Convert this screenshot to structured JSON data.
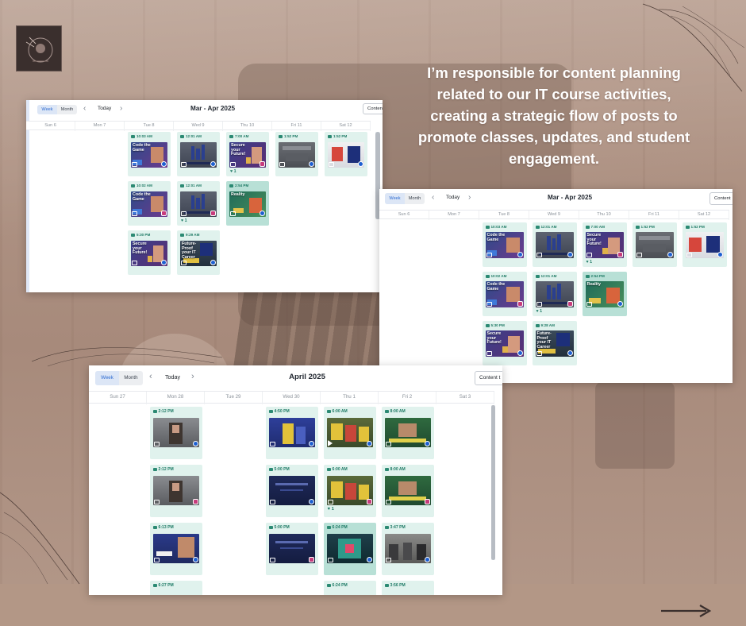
{
  "headline": "I’m responsible for content planning related to our IT course activities, creating a strategic flow of posts to promote classes, updates, and student engagement.",
  "colors": {
    "background": "#b09383",
    "card_scheduled": "#e0f2ed",
    "card_selected": "#b8e0d6",
    "time_text": "#1e7a65",
    "active_toggle": "#2d6bd1",
    "facebook": "#1d5fd1",
    "instagram": "#c73b7c"
  },
  "icons": {
    "next": "arrow-right-icon",
    "facebook": "facebook-icon",
    "instagram": "instagram-icon",
    "post_type": "image-icon",
    "video": "play-icon",
    "likes": "heart-icon",
    "scheduled": "calendar-icon"
  },
  "calendars": [
    {
      "toggle": {
        "week": "Week",
        "month": "Month",
        "active": "week"
      },
      "today": "Today",
      "range_title": "Mar - Apr 2025",
      "content_button": "Content",
      "days": [
        "Sun 6",
        "Mon 7",
        "Tue 8",
        "Wed 9",
        "Thu 10",
        "Fri 11",
        "Sat 12"
      ],
      "posts": [
        {
          "day": 2,
          "row": 0,
          "time": "10:03 AM",
          "thumb": "Code the Game",
          "theme": "code",
          "network": "fb"
        },
        {
          "day": 3,
          "row": 0,
          "time": "12:01 AM",
          "thumb": "",
          "theme": "bars",
          "network": "fb"
        },
        {
          "day": 4,
          "row": 0,
          "time": "7:00 AM",
          "thumb": "Secure your Future!",
          "theme": "secure",
          "network": "ig",
          "likes": "1"
        },
        {
          "day": 5,
          "row": 0,
          "time": "1:52 PM",
          "thumb": "",
          "theme": "grey",
          "network": "fb"
        },
        {
          "day": 6,
          "row": 0,
          "time": "1:52 PM",
          "thumb": "",
          "theme": "logo",
          "network": "fb"
        },
        {
          "day": 2,
          "row": 1,
          "time": "10:02 AM",
          "thumb": "Code the Game",
          "theme": "code",
          "network": "ig"
        },
        {
          "day": 3,
          "row": 1,
          "time": "12:01 AM",
          "thumb": "",
          "theme": "bars",
          "network": "ig",
          "likes": "1"
        },
        {
          "day": 4,
          "row": 1,
          "time": "2:54 PM",
          "thumb": "Reality",
          "theme": "reality",
          "network": "fb",
          "selected": true
        },
        {
          "day": 2,
          "row": 2,
          "time": "5:30 PM",
          "thumb": "Secure your Future!",
          "theme": "secure",
          "network": "fb"
        },
        {
          "day": 3,
          "row": 2,
          "time": "9:29 AM",
          "thumb": "Future-Proof your IT Career",
          "theme": "future",
          "network": "fb"
        }
      ]
    },
    {
      "toggle": {
        "week": "Week",
        "month": "Month",
        "active": "week"
      },
      "today": "Today",
      "range_title": "Mar - Apr 2025",
      "content_button": "Content",
      "days": [
        "Sun 6",
        "Mon 7",
        "Tue 8",
        "Wed 9",
        "Thu 10",
        "Fri 11",
        "Sat 12"
      ],
      "posts": [
        {
          "day": 2,
          "row": 0,
          "time": "10:03 AM",
          "thumb": "Code the Game",
          "theme": "code",
          "network": "fb"
        },
        {
          "day": 3,
          "row": 0,
          "time": "12:01 AM",
          "thumb": "",
          "theme": "bars",
          "network": "fb"
        },
        {
          "day": 4,
          "row": 0,
          "time": "7:00 AM",
          "thumb": "Secure your Future!",
          "theme": "secure",
          "network": "ig",
          "likes": "1"
        },
        {
          "day": 5,
          "row": 0,
          "time": "1:52 PM",
          "thumb": "",
          "theme": "grey",
          "network": "fb"
        },
        {
          "day": 6,
          "row": 0,
          "time": "1:52 PM",
          "thumb": "",
          "theme": "logo",
          "network": "fb"
        },
        {
          "day": 2,
          "row": 1,
          "time": "10:02 AM",
          "thumb": "Code the Game",
          "theme": "code",
          "network": "ig"
        },
        {
          "day": 3,
          "row": 1,
          "time": "12:01 AM",
          "thumb": "",
          "theme": "bars",
          "network": "ig",
          "likes": "1"
        },
        {
          "day": 4,
          "row": 1,
          "time": "2:54 PM",
          "thumb": "Reality",
          "theme": "reality",
          "network": "fb",
          "selected": true
        },
        {
          "day": 2,
          "row": 2,
          "time": "5:30 PM",
          "thumb": "Secure your Future!",
          "theme": "secure",
          "network": "fb"
        },
        {
          "day": 3,
          "row": 2,
          "time": "9:28 AM",
          "thumb": "Future-Proof your IT Career",
          "theme": "future",
          "network": "fb"
        }
      ]
    },
    {
      "toggle": {
        "week": "Week",
        "month": "Month",
        "active": "week"
      },
      "today": "Today",
      "range_title": "April 2025",
      "content_button": "Content t",
      "days": [
        "Sun 27",
        "Mon 28",
        "Tue 29",
        "Wed 30",
        "Thu 1",
        "Fri 2",
        "Sat 3"
      ],
      "posts": [
        {
          "day": 1,
          "row": 0,
          "time": "2:12 PM",
          "thumb": "",
          "theme": "photo",
          "network": "fb"
        },
        {
          "day": 3,
          "row": 0,
          "time": "4:50 PM",
          "thumb": "",
          "theme": "class",
          "network": "fb"
        },
        {
          "day": 4,
          "row": 0,
          "time": "6:00 AM",
          "thumb": "",
          "theme": "lego",
          "network": "fb",
          "video": true
        },
        {
          "day": 5,
          "row": 0,
          "time": "8:00 AM",
          "thumb": "",
          "theme": "green",
          "network": "fb"
        },
        {
          "day": 1,
          "row": 1,
          "time": "2:12 PM",
          "thumb": "",
          "theme": "photo",
          "network": "ig"
        },
        {
          "day": 3,
          "row": 1,
          "time": "5:00 PM",
          "thumb": "",
          "theme": "navy",
          "network": "fb"
        },
        {
          "day": 4,
          "row": 1,
          "time": "6:00 AM",
          "thumb": "",
          "theme": "lego",
          "network": "ig",
          "likes": "1"
        },
        {
          "day": 5,
          "row": 1,
          "time": "8:00 AM",
          "thumb": "",
          "theme": "green",
          "network": "ig"
        },
        {
          "day": 1,
          "row": 2,
          "time": "6:13 PM",
          "thumb": "",
          "theme": "navy2",
          "network": "fb"
        },
        {
          "day": 3,
          "row": 2,
          "time": "5:00 PM",
          "thumb": "",
          "theme": "navy",
          "network": "ig"
        },
        {
          "day": 4,
          "row": 2,
          "time": "6:24 PM",
          "thumb": "",
          "theme": "teal",
          "network": "fb",
          "selected": true
        },
        {
          "day": 5,
          "row": 2,
          "time": "3:47 PM",
          "thumb": "",
          "theme": "meeting",
          "network": "fb"
        },
        {
          "day": 1,
          "row": 3,
          "time": "6:27 PM",
          "thumb": "",
          "theme": "none",
          "network": "fb"
        },
        {
          "day": 4,
          "row": 3,
          "time": "6:24 PM",
          "thumb": "",
          "theme": "none",
          "network": "fb"
        },
        {
          "day": 5,
          "row": 3,
          "time": "3:56 PM",
          "thumb": "",
          "theme": "none",
          "network": "fb"
        }
      ]
    }
  ]
}
